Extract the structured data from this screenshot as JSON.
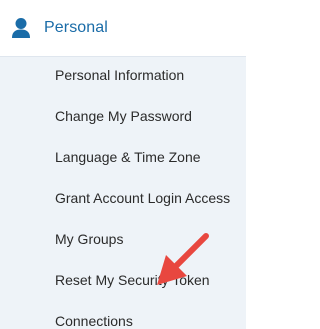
{
  "header": {
    "label": "Personal",
    "icon": "user-icon",
    "accent_color": "#1a6ca8"
  },
  "menu": {
    "items": [
      {
        "label": "Personal Information"
      },
      {
        "label": "Change My Password"
      },
      {
        "label": "Language & Time Zone"
      },
      {
        "label": "Grant Account Login Access"
      },
      {
        "label": "My Groups"
      },
      {
        "label": "Reset My Security Token"
      },
      {
        "label": "Connections"
      }
    ]
  },
  "annotation": {
    "icon": "red-arrow-icon",
    "color": "#e8473f"
  }
}
